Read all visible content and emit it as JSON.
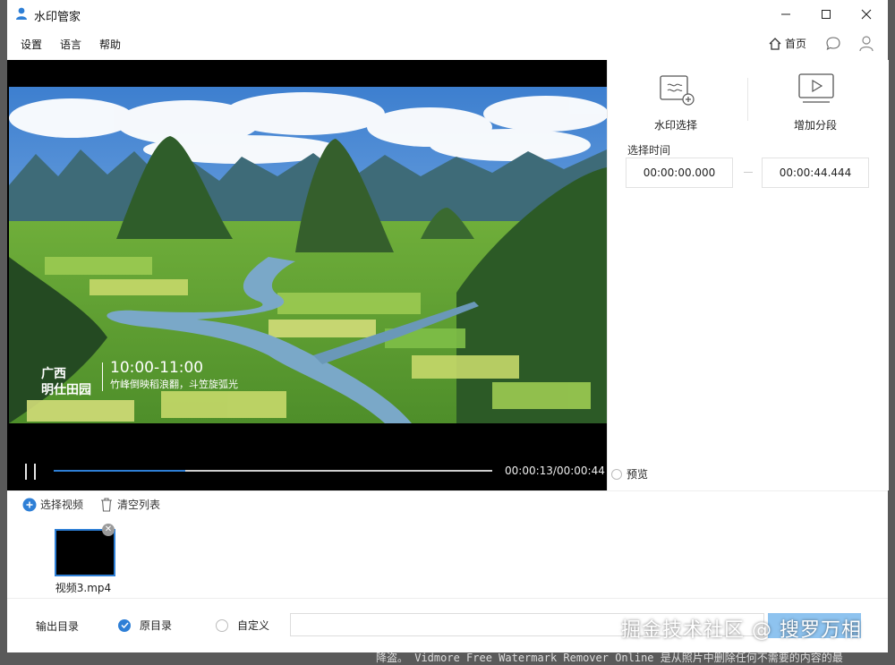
{
  "window": {
    "title": "水印管家"
  },
  "menu": [
    "设置",
    "语言",
    "帮助"
  ],
  "header": {
    "home_label": "首页"
  },
  "video": {
    "caption_brand_line1": "广西",
    "caption_brand_line2": "明仕田园",
    "caption_time": "10:00-11:00",
    "caption_sub": "竹峰倒映稻浪翻，斗笠旋弧光"
  },
  "player": {
    "time": "00:00:13/00:00:44",
    "progress": 0.3
  },
  "tools": {
    "watermark_select": "水印选择",
    "add_segment": "增加分段"
  },
  "time_select": {
    "title": "选择时间",
    "start": "00:00:00.000",
    "end": "00:00:44.444"
  },
  "preview_label": "预览",
  "files": {
    "add_label": "选择视频",
    "clear_label": "清空列表",
    "items": [
      {
        "name": "视频3.mp4"
      }
    ]
  },
  "output": {
    "label": "输出目录",
    "option_original": "原目录",
    "option_custom": "自定义",
    "path_value": ""
  },
  "overlay_watermark": "掘金技术社区 @ 搜罗万相",
  "background_text": "降盗。 Vidmore Free Watermark Remover Online 是从照片中删除任何不需要的内容的最",
  "colors": {
    "accent": "#2e7fd6",
    "button": "#8ec3ef"
  }
}
